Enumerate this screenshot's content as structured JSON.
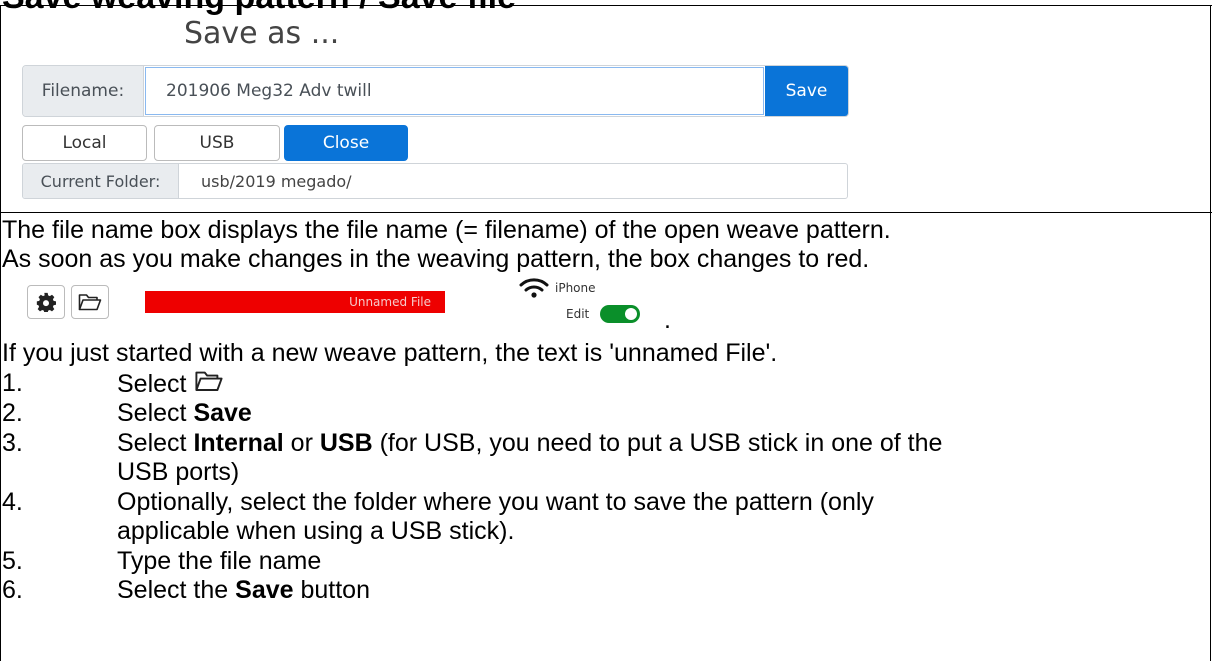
{
  "doc": {
    "title": "Save weaving pattern / Save file",
    "para1": "The file name box displays the file name (= filename) of the open weave pattern.",
    "para2": "As soon as you make changes in the weaving pattern, the box changes to red.",
    "para3": "If you just started with a new weave pattern, the text is 'unnamed File'.",
    "trailing_dot": "."
  },
  "dialog": {
    "title": "Save as ...",
    "filename_label": "Filename:",
    "filename_value": "201906 Meg32 Adv twill",
    "save_button": "Save",
    "local_button": "Local",
    "usb_button": "USB",
    "close_button": "Close",
    "folder_label": "Current Folder:",
    "folder_value": "usb/2019 megado/"
  },
  "toolbar": {
    "status_text": "Unnamed File",
    "wifi_label": "iPhone",
    "edit_label": "Edit",
    "edit_toggle_on": true,
    "status_color": "#ee0000",
    "accent_color": "#0a74d8",
    "icons": [
      "gear-icon",
      "folder-open-icon",
      "wifi-icon"
    ]
  },
  "steps": [
    {
      "num": "1.",
      "line1": "Select"
    },
    {
      "num": "2.",
      "pre": "Select ",
      "bold": "Save"
    },
    {
      "num": "3.",
      "pre": "Select ",
      "bold": "Internal",
      "mid": " or ",
      "bold2": "USB",
      "post": " (for USB, you need to put a USB stick in one of the",
      "line2": "USB ports)"
    },
    {
      "num": "4.",
      "line1": "Optionally, select the folder where you want to save the pattern (only",
      "line2": "applicable when using a USB stick)."
    },
    {
      "num": "5.",
      "line1": "Type the file name"
    },
    {
      "num": "6.",
      "pre": "Select the ",
      "bold": "Save",
      "post": " button"
    }
  ]
}
